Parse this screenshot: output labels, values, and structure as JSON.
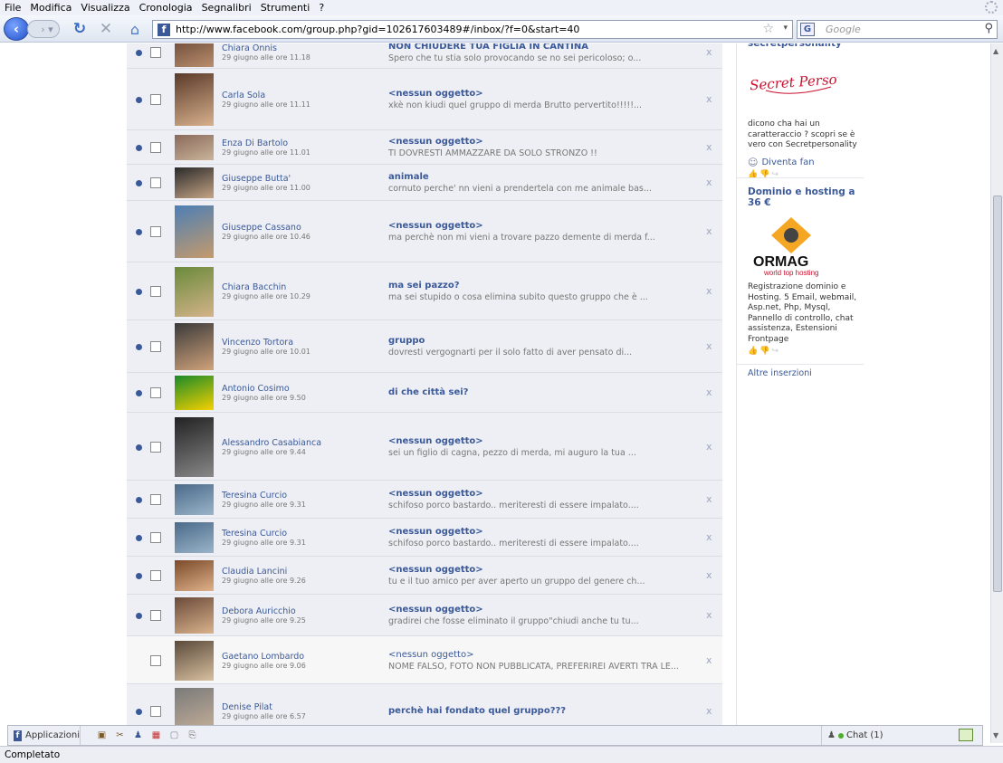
{
  "browser": {
    "menu": [
      "File",
      "Modifica",
      "Visualizza",
      "Cronologia",
      "Segnalibri",
      "Strumenti",
      "?"
    ],
    "url": "http://www.facebook.com/group.php?gid=102617603489#/inbox/?f=0&start=40",
    "search_placeholder": "Google",
    "status": "Completato"
  },
  "messages": [
    {
      "sender": "Chiara Onnis",
      "date": "29 giugno alle ore 11.18",
      "subject": "NON CHIUDERE TUA FIGLIA IN CANTINA",
      "snippet": "Spero che tu stia solo provocando se no sei pericoloso; o...",
      "unread": true
    },
    {
      "sender": "Carla Sola",
      "date": "29 giugno alle ore 11.11",
      "subject": "<nessun oggetto>",
      "snippet": "xkè non kiudi quel gruppo di merda Brutto pervertito!!!!!...",
      "unread": true
    },
    {
      "sender": "Enza Di Bartolo",
      "date": "29 giugno alle ore 11.01",
      "subject": "<nessun oggetto>",
      "snippet": "TI DOVRESTI AMMAZZARE DA SOLO STRONZO !!",
      "unread": true
    },
    {
      "sender": "Giuseppe Butta'",
      "date": "29 giugno alle ore 11.00",
      "subject": "animale",
      "snippet": "cornuto perche' nn vieni a prendertela con me animale bas...",
      "unread": true
    },
    {
      "sender": "Giuseppe Cassano",
      "date": "29 giugno alle ore 10.46",
      "subject": "<nessun oggetto>",
      "snippet": "ma perchè non mi vieni a trovare pazzo demente di merda f...",
      "unread": true
    },
    {
      "sender": "Chiara Bacchin",
      "date": "29 giugno alle ore 10.29",
      "subject": "ma sei pazzo?",
      "snippet": "ma sei stupido o cosa elimina subito questo gruppo che è ...",
      "unread": true
    },
    {
      "sender": "Vincenzo Tortora",
      "date": "29 giugno alle ore 10.01",
      "subject": "gruppo",
      "snippet": "dovresti vergognarti per il solo fatto di aver pensato di...",
      "unread": true
    },
    {
      "sender": "Antonio Cosimo",
      "date": "29 giugno alle ore 9.50",
      "subject": "di che città sei?",
      "snippet": "",
      "unread": true
    },
    {
      "sender": "Alessandro Casabianca",
      "date": "29 giugno alle ore 9.44",
      "subject": "<nessun oggetto>",
      "snippet": "sei un figlio di cagna, pezzo di merda, mi auguro la tua ...",
      "unread": true
    },
    {
      "sender": "Teresina Curcio",
      "date": "29 giugno alle ore 9.31",
      "subject": "<nessun oggetto>",
      "snippet": "schifoso porco bastardo.. meriteresti di essere impalato....",
      "unread": true
    },
    {
      "sender": "Teresina Curcio",
      "date": "29 giugno alle ore 9.31",
      "subject": "<nessun oggetto>",
      "snippet": "schifoso porco bastardo.. meriteresti di essere impalato....",
      "unread": true
    },
    {
      "sender": "Claudia Lancini",
      "date": "29 giugno alle ore 9.26",
      "subject": "<nessun oggetto>",
      "snippet": "tu e il tuo amico per aver aperto un gruppo del genere ch...",
      "unread": true
    },
    {
      "sender": "Debora Auricchio",
      "date": "29 giugno alle ore 9.25",
      "subject": "<nessun oggetto>",
      "snippet": "gradirei che fosse eliminato il gruppo\"chiudi anche tu tu...",
      "unread": true
    },
    {
      "sender": "Gaetano Lombardo",
      "date": "29 giugno alle ore 9.06",
      "subject": "<nessun oggetto>",
      "snippet": "NOME FALSO, FOTO NON PUBBLICATA, PREFERIREI AVERTI TRA LE...",
      "unread": false
    },
    {
      "sender": "Denise Pilat",
      "date": "29 giugno alle ore 6.57",
      "subject": "perchè hai fondato quel gruppo???",
      "snippet": "",
      "unread": true
    }
  ],
  "sidebar": {
    "ad1": {
      "title": "secretpersonality",
      "logo": "Secret Personality",
      "text": "dicono cha hai un caratteraccio ? scopri se è vero con Secretpersonality",
      "fan": "Diventa fan"
    },
    "ad2": {
      "title": "Dominio e hosting a 36 €",
      "logo": "ORMAG",
      "tagline": "world top hosting",
      "text": "Registrazione dominio e Hosting. 5 Email, webmail, Asp.net, Php, Mysql, Pannello di controllo, chat assistenza, Estensioni Frontpage"
    },
    "more": "Altre inserzioni"
  },
  "fbbar": {
    "apps": "Applicazioni",
    "chat_label": "Chat",
    "chat_count": "(1)"
  },
  "colors": {
    "fb_blue": "#3b5998",
    "ad_red": "#c8102e"
  }
}
